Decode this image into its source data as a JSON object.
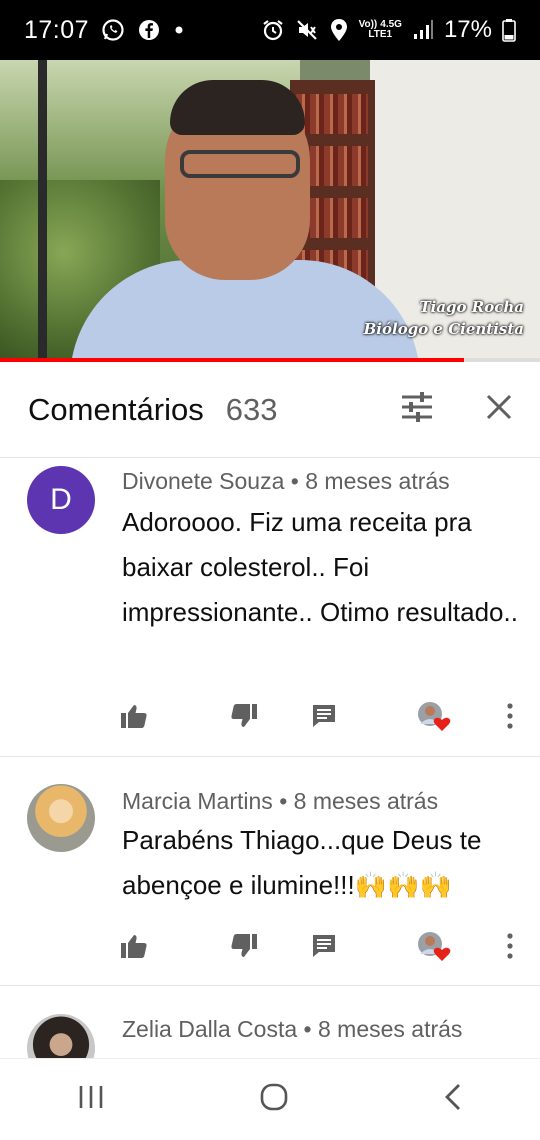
{
  "status_bar": {
    "time": "17:07",
    "network_top": "4.5G",
    "network_bottom": "LTE1",
    "volte": "Vo))",
    "battery": "17%",
    "icons": [
      "whatsapp-icon",
      "facebook-icon",
      "dot-icon",
      "alarm-icon",
      "mute-icon",
      "location-icon",
      "signal-icon",
      "battery-icon"
    ]
  },
  "video": {
    "caption_line1": "Tiago Rocha",
    "caption_line2": "Biólogo e Cientista",
    "progress": 0.86
  },
  "comments_header": {
    "title": "Comentários",
    "count": "633",
    "icons": [
      "sort-filter-icon",
      "close-icon"
    ]
  },
  "comments": [
    {
      "author": "Divonete Souza",
      "separator": "•",
      "time": "8 meses atrás",
      "avatar_letter": "D",
      "text": "Adoroooo. Fiz uma receita pra baixar colesterol.. Foi impressionante.. Otimo resultado.."
    },
    {
      "author": "Marcia Martins",
      "separator": "•",
      "time": "8 meses atrás",
      "text": "Parabéns Thiago...que Deus te abençoe e ilumine!!!🙌🙌🙌"
    },
    {
      "author": "Zelia Dalla Costa",
      "separator": "•",
      "time": "8 meses atrás",
      "text": ""
    }
  ],
  "colors": {
    "accent": "#ff0000",
    "avatar_purple": "#5e35b1",
    "secondary_text": "#606060",
    "status_bar": "#000000"
  }
}
